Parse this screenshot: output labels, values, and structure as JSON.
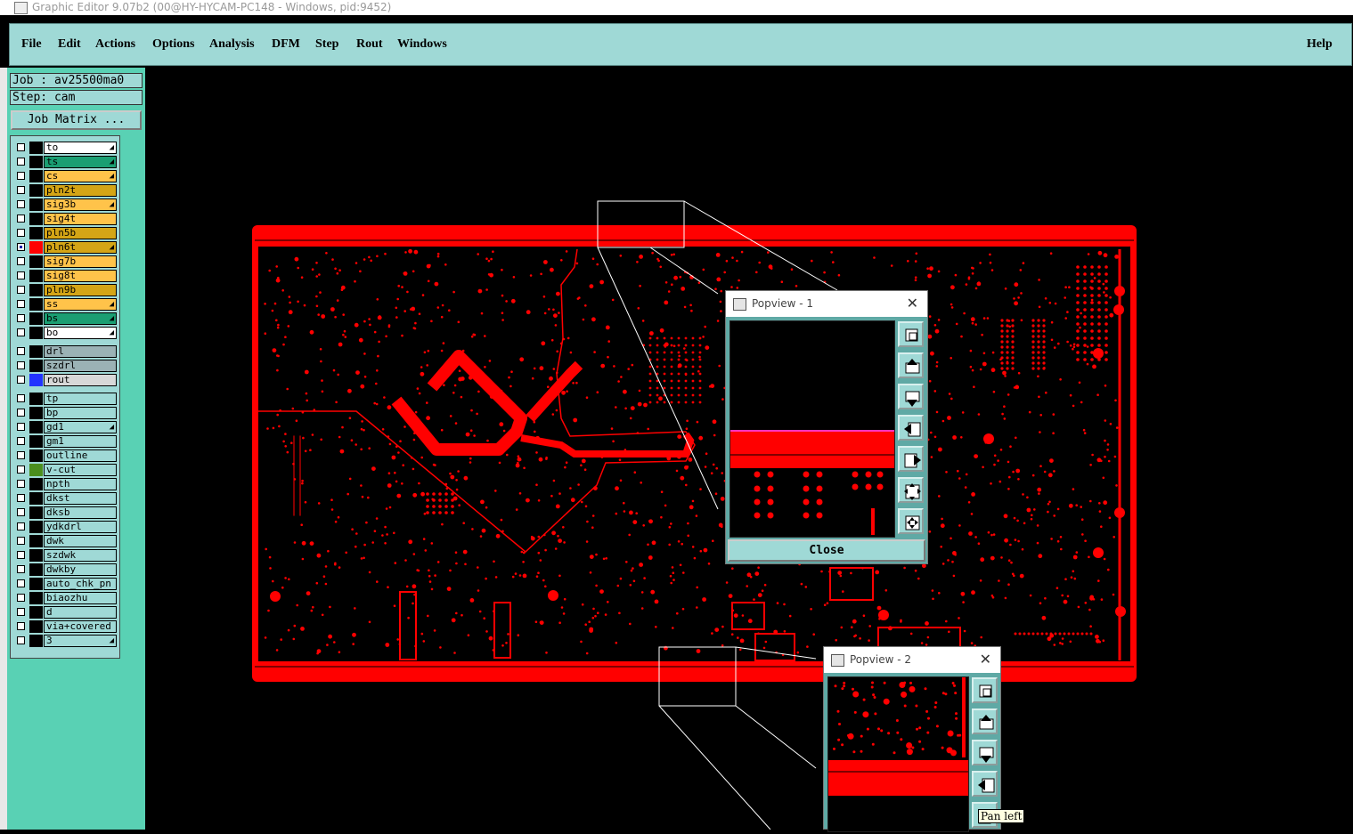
{
  "window": {
    "title": "Graphic Editor 9.07b2 (00@HY-HYCAM-PC148 - Windows, pid:9452)"
  },
  "menu": {
    "items": [
      "File",
      "Edit",
      "Actions",
      "Options",
      "Analysis",
      "DFM",
      "Step",
      "Rout",
      "Windows"
    ],
    "help": "Help"
  },
  "job": {
    "job": "Job : av25500ma0",
    "step": "Step: cam",
    "matrix_button": "Job Matrix ..."
  },
  "colors": {
    "board_red": "#ff0000",
    "panel_teal": "#59d1b4",
    "light_teal": "#9fd9d6"
  },
  "layers": [
    {
      "name": "to",
      "color": "#ffffff",
      "swatch": "#000000",
      "arrow": true
    },
    {
      "name": "ts",
      "color": "#1a9e72",
      "swatch": "#000000",
      "arrow": true
    },
    {
      "name": "cs",
      "color": "#ffc34a",
      "swatch": "#000000",
      "arrow": true
    },
    {
      "name": "pln2t",
      "color": "#d4a516",
      "swatch": "#000000",
      "arrow": false
    },
    {
      "name": "sig3b",
      "color": "#ffc34a",
      "swatch": "#000000",
      "arrow": true
    },
    {
      "name": "sig4t",
      "color": "#ffc34a",
      "swatch": "#000000",
      "arrow": false
    },
    {
      "name": "pln5b",
      "color": "#d4a516",
      "swatch": "#000000",
      "arrow": false
    },
    {
      "name": "pln6t",
      "color": "#d4a516",
      "swatch": "#ff0000",
      "arrow": true,
      "active": true
    },
    {
      "name": "sig7b",
      "color": "#ffc34a",
      "swatch": "#000000",
      "arrow": false
    },
    {
      "name": "sig8t",
      "color": "#ffc34a",
      "swatch": "#000000",
      "arrow": false
    },
    {
      "name": "pln9b",
      "color": "#d4a516",
      "swatch": "#000000",
      "arrow": false
    },
    {
      "name": "ss",
      "color": "#ffc34a",
      "swatch": "#000000",
      "arrow": true
    },
    {
      "name": "bs",
      "color": "#1a9e72",
      "swatch": "#000000",
      "arrow": true
    },
    {
      "name": "bo",
      "color": "#ffffff",
      "swatch": "#000000",
      "arrow": true
    },
    {
      "name": "drl",
      "color": "#9bb2b5",
      "swatch": "#000000",
      "arrow": false,
      "gap": true
    },
    {
      "name": "szdrl",
      "color": "#9bb2b5",
      "swatch": "#000000",
      "arrow": false
    },
    {
      "name": "rout",
      "color": "#d8d8d8",
      "swatch": "#2233ff",
      "arrow": false
    },
    {
      "name": "tp",
      "color": "#9fd9d6",
      "swatch": "#000000",
      "arrow": false,
      "gap": true
    },
    {
      "name": "bp",
      "color": "#9fd9d6",
      "swatch": "#000000",
      "arrow": false
    },
    {
      "name": "gd1",
      "color": "#9fd9d6",
      "swatch": "#000000",
      "arrow": true
    },
    {
      "name": "gm1",
      "color": "#9fd9d6",
      "swatch": "#000000",
      "arrow": false
    },
    {
      "name": "outline",
      "color": "#9fd9d6",
      "swatch": "#000000",
      "arrow": false
    },
    {
      "name": "v-cut",
      "color": "#9fd9d6",
      "swatch": "#4b8f1e",
      "arrow": false
    },
    {
      "name": "npth",
      "color": "#9fd9d6",
      "swatch": "#000000",
      "arrow": false
    },
    {
      "name": "dkst",
      "color": "#9fd9d6",
      "swatch": "#000000",
      "arrow": false
    },
    {
      "name": "dksb",
      "color": "#9fd9d6",
      "swatch": "#000000",
      "arrow": false
    },
    {
      "name": "ydkdrl",
      "color": "#9fd9d6",
      "swatch": "#000000",
      "arrow": false
    },
    {
      "name": "dwk",
      "color": "#9fd9d6",
      "swatch": "#000000",
      "arrow": false
    },
    {
      "name": "szdwk",
      "color": "#9fd9d6",
      "swatch": "#000000",
      "arrow": false
    },
    {
      "name": "dwkby",
      "color": "#9fd9d6",
      "swatch": "#000000",
      "arrow": false
    },
    {
      "name": "auto_chk_pn",
      "color": "#9fd9d6",
      "swatch": "#000000",
      "arrow": false
    },
    {
      "name": "biaozhu",
      "color": "#9fd9d6",
      "swatch": "#000000",
      "arrow": false
    },
    {
      "name": "d",
      "color": "#9fd9d6",
      "swatch": "#000000",
      "arrow": false
    },
    {
      "name": "via+covered",
      "color": "#9fd9d6",
      "swatch": "#000000",
      "arrow": false
    },
    {
      "name": "3",
      "color": "#9fd9d6",
      "swatch": "#000000",
      "arrow": true
    }
  ],
  "popview1": {
    "title": "Popview - 1",
    "close_label": "Close"
  },
  "popview2": {
    "title": "Popview - 2"
  },
  "popview_tools": [
    "zoom-window-icon",
    "pan-up-icon",
    "pan-down-icon",
    "pan-left-icon",
    "pan-right-icon",
    "zoom-out-icon",
    "zoom-in-icon"
  ],
  "tooltip": {
    "text": "Pan left"
  }
}
